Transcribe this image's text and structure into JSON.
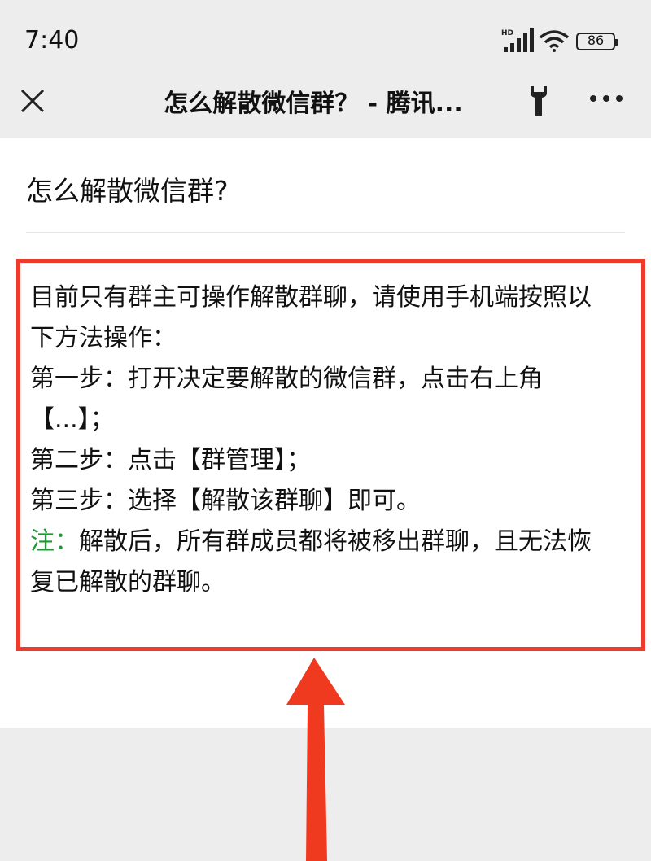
{
  "status_bar": {
    "time": "7:40",
    "network": "HD",
    "battery": "86"
  },
  "nav": {
    "title": "怎么解散微信群？ - 腾讯..."
  },
  "article": {
    "title": "怎么解散微信群?",
    "lines": [
      "目前只有群主可操作解散群聊，请使用手机端按照以",
      "下方法操作：",
      "第一步：打开决定要解散的微信群，点击右上角",
      "【...】；",
      "第二步：点击【群管理】；",
      "第三步：选择【解散该群聊】即可。"
    ],
    "note_label": "注：",
    "note_line1": "解散后，所有群成员都将被移出群聊，且无法恢",
    "note_line2": "复已解散的群聊。"
  },
  "colors": {
    "highlight": "#ee3b2b",
    "note": "#1a9b2e",
    "background": "#ededed"
  },
  "icons": [
    "close-icon",
    "wrench-icon",
    "more-icon",
    "signal-icon",
    "wifi-icon",
    "battery-icon",
    "arrow-up-icon"
  ]
}
